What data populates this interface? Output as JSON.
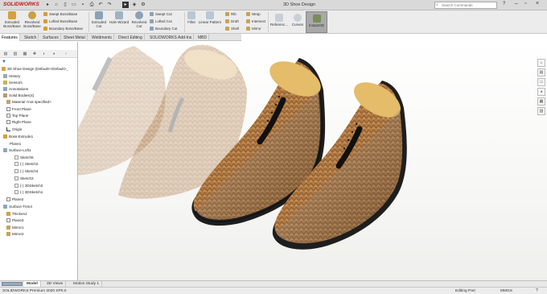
{
  "app": {
    "logo": "SOLIDWORKS",
    "document_title": "3D Shoe Design",
    "search_placeholder": "Search Commands"
  },
  "ribbon": {
    "extruded_boss": "Extruded\nBoss/Base",
    "revolved_boss": "Revolved\nBoss/Base",
    "swept_boss": "Swept Boss/Base",
    "lofted_boss": "Lofted Boss/Base",
    "boundary_boss": "Boundary Boss/Base",
    "extruded_cut": "Extruded\nCut",
    "hole_wizard": "Hole Wizard",
    "revolved_cut": "Revolved\nCut",
    "swept_cut": "Swept Cut",
    "lofted_cut": "Lofted Cut",
    "boundary_cut": "Boundary Cut",
    "fillet": "Fillet",
    "linear_pattern": "Linear Pattern",
    "rib": "Rib",
    "draft": "Draft",
    "shell": "Shell",
    "wrap": "Wrap",
    "intersect": "Intersect",
    "mirror": "Mirror",
    "reference": "Referenc...",
    "curves": "Curves",
    "instant3d": "Instant3D"
  },
  "command_tabs": [
    "Features",
    "Sketch",
    "Surfaces",
    "Sheet Metal",
    "Weldments",
    "Direct Editing",
    "SOLIDWORKS Add-Ins",
    "MBD"
  ],
  "tree": {
    "root": "3D Shoe Design  (Default<<Default>_",
    "items": [
      "History",
      "Sensors",
      "Annotations",
      "Solid Bodies(4)",
      "Material <not specified>",
      "Front Plane",
      "Top Plane",
      "Right Plane",
      "Origin",
      "Boss-Extrude1",
      "Plane1",
      "Surface-Loft1",
      "Sketch5",
      "(-) Sketch2",
      "(-) Sketch4",
      "Sketch3",
      "(-) 3DSketch2",
      "(-) 3DSketch1",
      "Plane2",
      "Surface-Trim4",
      "Thicken2",
      "Plane3",
      "Mirror1",
      "Mirror2"
    ]
  },
  "bottom_tabs": [
    "Model",
    "3D Views",
    "Motion Study 1"
  ],
  "status": {
    "left": "SOLIDWORKS Premium 2020 SP0.0",
    "mode": "Editing Part",
    "units": "MMGS",
    "help": "?"
  },
  "colors": {
    "brand_red": "#c4161c",
    "leather": "#b07a45",
    "sole": "#1e1e1e",
    "insole": "#e4bc6a",
    "viewport_bg": "#f7f7f5"
  }
}
